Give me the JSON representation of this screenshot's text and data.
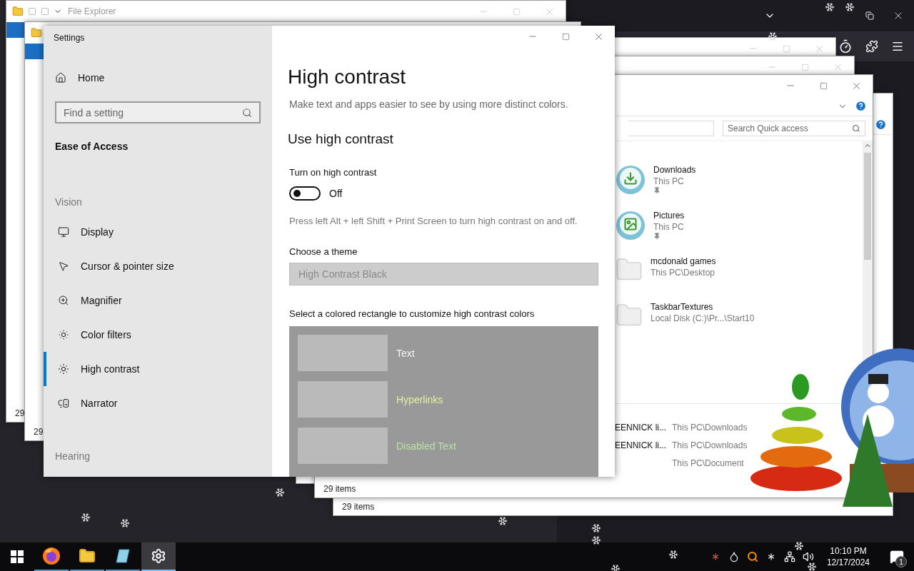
{
  "back_explorers": [
    {
      "title": "File Explorer",
      "status": "29"
    },
    {
      "status": "29"
    }
  ],
  "settings": {
    "title": "Settings",
    "home": "Home",
    "search": {
      "placeholder": "Find a setting"
    },
    "category": "Ease of Access",
    "groups": [
      {
        "heading": "Vision",
        "items": [
          {
            "label": "Display",
            "kind": "display",
            "selected": false
          },
          {
            "label": "Cursor & pointer size",
            "kind": "cursor",
            "selected": false
          },
          {
            "label": "Magnifier",
            "kind": "magnifier",
            "selected": false
          },
          {
            "label": "Color filters",
            "kind": "filters",
            "selected": false
          },
          {
            "label": "High contrast",
            "kind": "contrast",
            "selected": true
          },
          {
            "label": "Narrator",
            "kind": "narrator",
            "selected": false
          }
        ]
      },
      {
        "heading": "Hearing"
      }
    ],
    "page": {
      "title": "High contrast",
      "description": "Make text and apps easier to see by using more distinct colors.",
      "section": "Use high contrast",
      "toggle": {
        "label": "Turn on high contrast",
        "on": false,
        "state_text": "Off"
      },
      "hint": "Press left Alt + left Shift + Print Screen to turn high contrast on and off.",
      "theme": {
        "label": "Choose a theme",
        "value": "High Contrast Black",
        "disabled": true
      },
      "colors_label": "Select a colored rectangle to customize high contrast colors",
      "swatches": [
        {
          "label": "Text",
          "color": "#f4f4f4"
        },
        {
          "label": "Hyperlinks",
          "color": "#e6f29a"
        },
        {
          "label": "Disabled Text",
          "color": "#b9e3a6"
        }
      ]
    }
  },
  "explorer": {
    "search": {
      "placeholder": "Search Quick access"
    },
    "quick_access": [
      {
        "name": "Downloads",
        "location": "This PC",
        "kind": "downloads",
        "pinned": true
      },
      {
        "name": "Pictures",
        "location": "This PC",
        "kind": "pictures",
        "pinned": true
      },
      {
        "name": "mcdonald games",
        "location": "This PC\\Desktop",
        "kind": "folder",
        "pinned": false
      },
      {
        "name": "TaskbarTextures",
        "location": "Local Disk (C:)\\Pr...\\Start10",
        "kind": "folder",
        "pinned": false
      }
    ],
    "recent": [
      {
        "name": "EENNICK li...",
        "location": "This PC\\Downloads"
      },
      {
        "name": "EENNICK li...",
        "location": "This PC\\Downloads"
      },
      {
        "location": "This PC\\Document"
      }
    ],
    "status_bars": [
      "29 items",
      "29 items"
    ]
  },
  "taskbar": {
    "apps": [
      {
        "kind": "firefox",
        "selected": false
      },
      {
        "kind": "files",
        "selected": false
      },
      {
        "kind": "notepad",
        "selected": false
      },
      {
        "kind": "settings",
        "selected": true
      }
    ],
    "time": "10:10 PM",
    "date": "12/17/2024",
    "notifications": "1"
  }
}
